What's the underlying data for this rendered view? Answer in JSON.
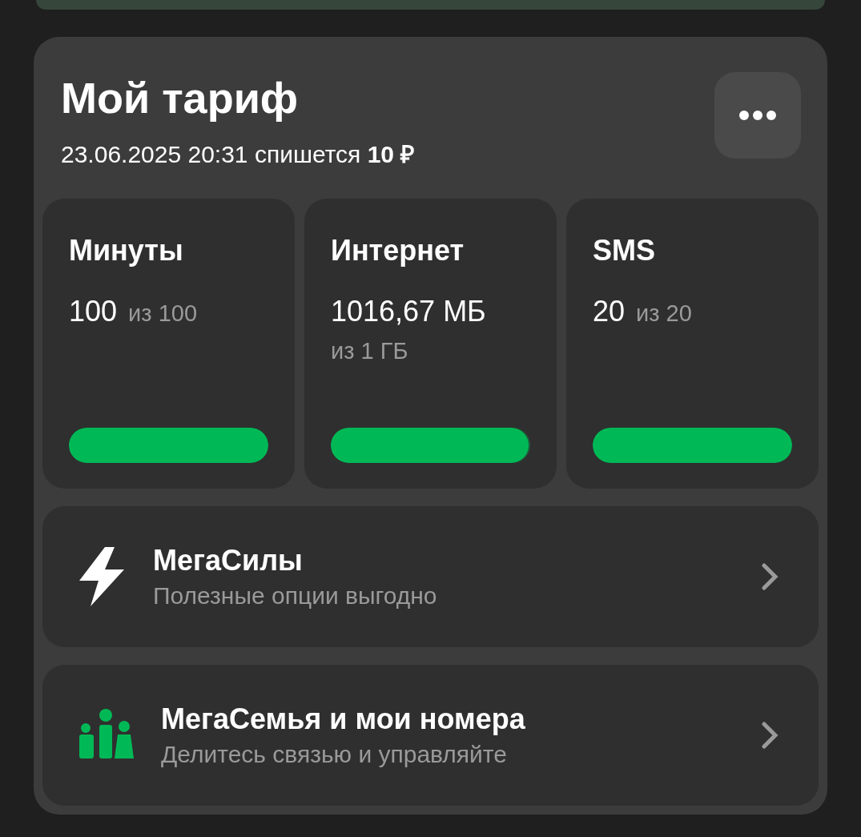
{
  "tariff": {
    "title": "Мой тариф",
    "charge": "23.06.2025 20:31 спишется **10 ₽**"
  },
  "counters": [
    {
      "title": "Минуты",
      "value": "100",
      "total": "из 100",
      "level": 1
    },
    {
      "title": "Интернет",
      "value": "1016,67 МБ",
      "total": "из 1 ГБ",
      "level": 0.99
    },
    {
      "title": "SMS",
      "value": "20",
      "total": "из 20",
      "level": 1
    }
  ],
  "options": [
    {
      "kind": "bolt",
      "title": "МегаСилы",
      "subtitle": "Полезные опции выгодно"
    },
    {
      "kind": "family",
      "title": "МегаСемья и мои номера",
      "subtitle": "Делитесь связью и управляйте"
    }
  ]
}
